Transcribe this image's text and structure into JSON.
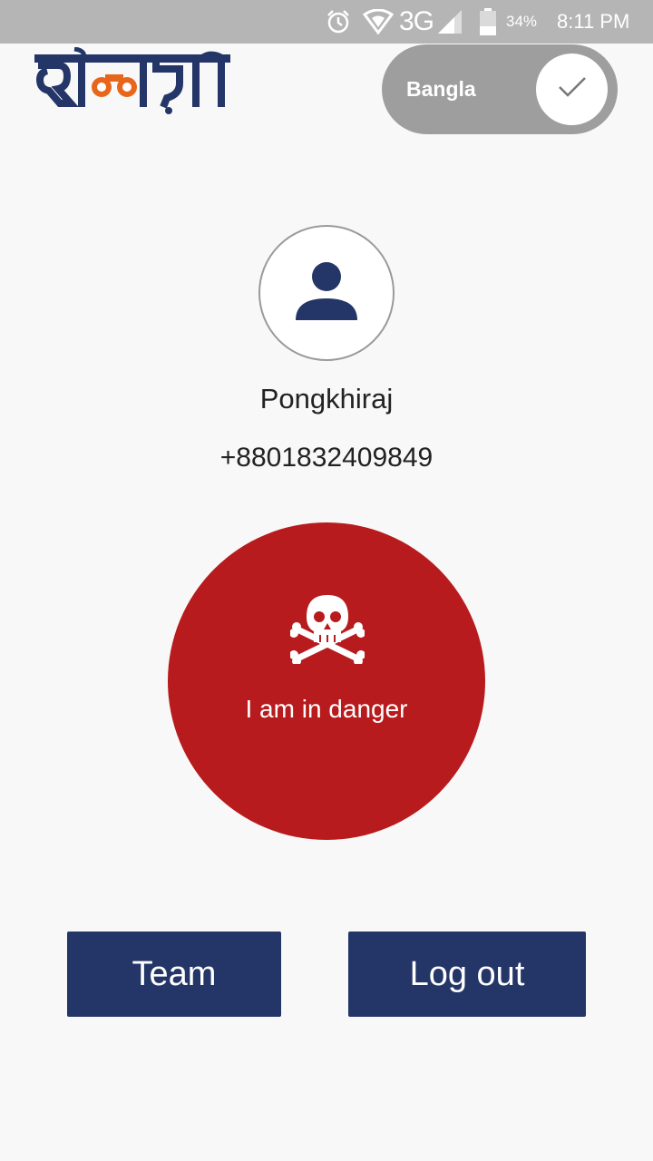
{
  "status_bar": {
    "network": "3G",
    "battery_percent": "34%",
    "time": "8:11 PM",
    "icons": [
      "alarm-icon",
      "wifi-icon",
      "signal-icon",
      "battery-icon"
    ]
  },
  "header": {
    "logo_text": "দিশারী",
    "language_toggle": {
      "label": "Bangla",
      "checked": true
    }
  },
  "profile": {
    "name": "Pongkhiraj",
    "phone": "+8801832409849",
    "avatar_icon": "person-icon"
  },
  "danger": {
    "label": "I am in danger",
    "icon": "skull-crossbones-icon",
    "color": "#b71b1d"
  },
  "actions": {
    "team_label": "Team",
    "logout_label": "Log out",
    "color": "#243567"
  }
}
